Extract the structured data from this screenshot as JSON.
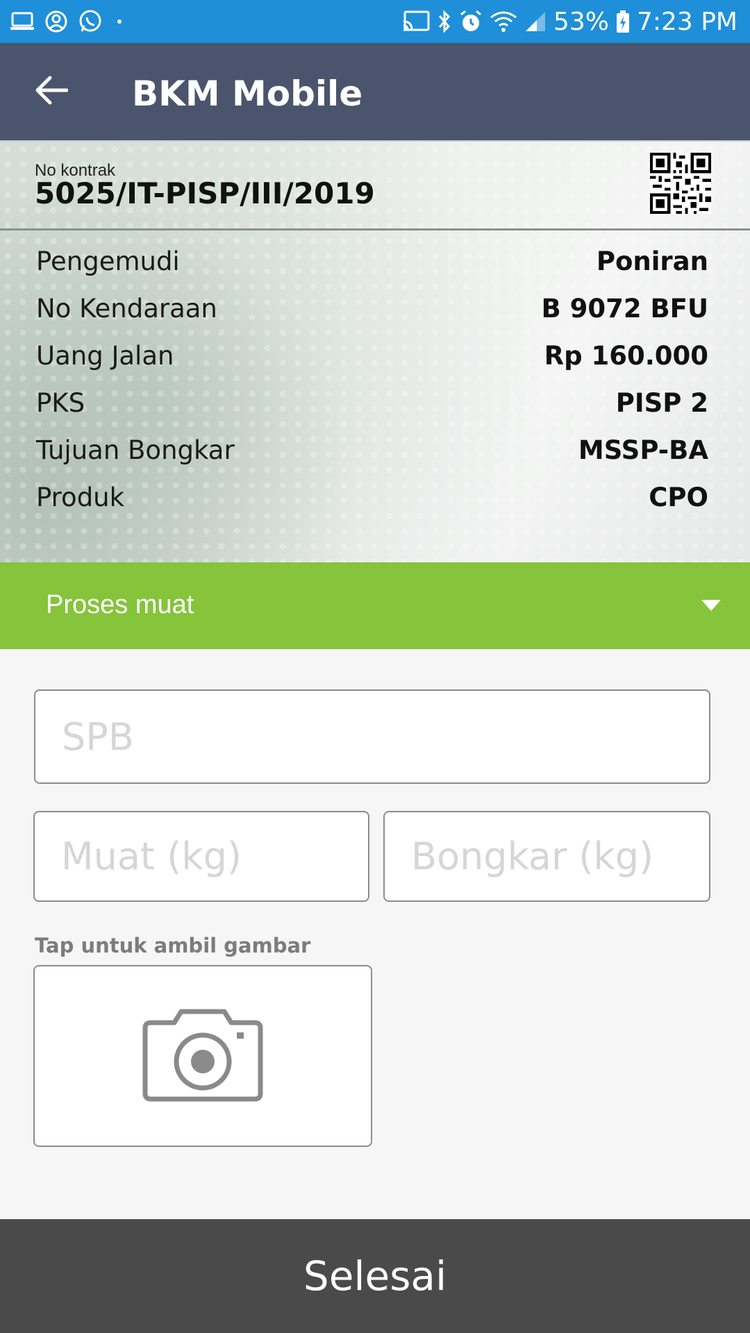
{
  "status_bar": {
    "left_icons": [
      "laptop-icon",
      "account-circle-icon",
      "whatsapp-icon",
      "dot-icon"
    ],
    "right_icons": [
      "cast-icon",
      "bluetooth-icon",
      "alarm-icon",
      "wifi-icon",
      "signal-icon",
      "battery-icon"
    ],
    "battery": "53%",
    "time": "7:23 PM"
  },
  "app_bar": {
    "title": "BKM Mobile",
    "back_icon": "arrow-left-icon"
  },
  "contract": {
    "label": "No kontrak",
    "number": "5025/IT-PISP/III/2019"
  },
  "details": [
    {
      "label": "Pengemudi",
      "value": "Poniran"
    },
    {
      "label": "No Kendaraan",
      "value": "B 9072 BFU"
    },
    {
      "label": "Uang Jalan",
      "value": "Rp 160.000"
    },
    {
      "label": "PKS",
      "value": "PISP 2"
    },
    {
      "label": "Tujuan Bongkar",
      "value": "MSSP-BA"
    },
    {
      "label": "Produk",
      "value": "CPO"
    }
  ],
  "dropdown": {
    "selected": "Proses muat"
  },
  "form": {
    "spb_placeholder": "SPB",
    "muat_placeholder": "Muat (kg)",
    "bongkar_placeholder": "Bongkar (kg)",
    "photo_caption": "Tap untuk ambil gambar",
    "photo_icon": "camera-icon"
  },
  "footer": {
    "finish_label": "Selesai"
  },
  "colors": {
    "status_bar": "#1e8fd8",
    "app_bar": "#4a546c",
    "dropdown": "#85c43b",
    "finish_button": "#4a4a4a"
  }
}
